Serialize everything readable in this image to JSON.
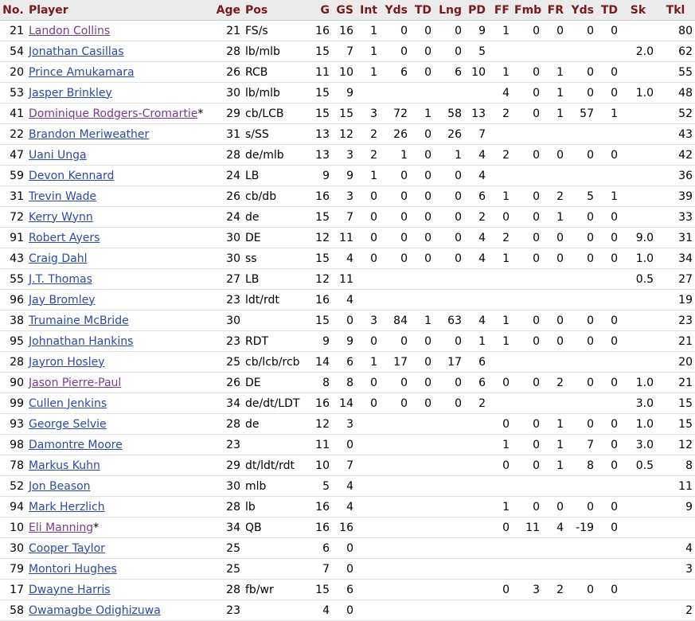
{
  "headers": [
    "No.",
    "Player",
    "Age",
    "Pos",
    "G",
    "GS",
    "Int",
    "Yds",
    "TD",
    "Lng",
    "PD",
    "FF",
    "Fmb",
    "FR",
    "Yds",
    "TD",
    "Sk",
    "Tkl"
  ],
  "rows": [
    [
      "21",
      "Landon Collins",
      "21",
      "FS/s",
      "16",
      "16",
      "1",
      "0",
      "0",
      "0",
      "9",
      "1",
      "0",
      "0",
      "0",
      "0",
      "",
      "80"
    ],
    [
      "54",
      "Jonathan Casillas",
      "28",
      "lb/mlb",
      "15",
      "7",
      "1",
      "0",
      "0",
      "0",
      "5",
      "",
      "",
      "",
      "",
      "",
      "2.0",
      "62"
    ],
    [
      "20",
      "Prince Amukamara",
      "26",
      "RCB",
      "11",
      "10",
      "1",
      "6",
      "0",
      "6",
      "10",
      "1",
      "0",
      "1",
      "0",
      "0",
      "",
      "55"
    ],
    [
      "53",
      "Jasper Brinkley",
      "30",
      "lb/mlb",
      "15",
      "9",
      "",
      "",
      "",
      "",
      "",
      "4",
      "0",
      "1",
      "0",
      "0",
      "1.0",
      "48"
    ],
    [
      "41",
      "Dominique Rodgers-Cromartie*",
      "29",
      "cb/LCB",
      "15",
      "15",
      "3",
      "72",
      "1",
      "58",
      "13",
      "2",
      "0",
      "1",
      "57",
      "1",
      "",
      "52"
    ],
    [
      "22",
      "Brandon Meriweather",
      "31",
      "s/SS",
      "13",
      "12",
      "2",
      "26",
      "0",
      "26",
      "7",
      "",
      "",
      "",
      "",
      "",
      "",
      "43"
    ],
    [
      "47",
      "Uani Unga",
      "28",
      "de/mlb",
      "13",
      "3",
      "2",
      "1",
      "0",
      "1",
      "4",
      "2",
      "0",
      "0",
      "0",
      "0",
      "",
      "42"
    ],
    [
      "59",
      "Devon Kennard",
      "24",
      "LB",
      "9",
      "9",
      "1",
      "0",
      "0",
      "0",
      "4",
      "",
      "",
      "",
      "",
      "",
      "",
      "36"
    ],
    [
      "31",
      "Trevin Wade",
      "26",
      "cb/db",
      "16",
      "3",
      "0",
      "0",
      "0",
      "0",
      "6",
      "1",
      "0",
      "2",
      "5",
      "1",
      "",
      "39"
    ],
    [
      "72",
      "Kerry Wynn",
      "24",
      "de",
      "15",
      "7",
      "0",
      "0",
      "0",
      "0",
      "2",
      "0",
      "0",
      "1",
      "0",
      "0",
      "",
      "33"
    ],
    [
      "91",
      "Robert Ayers",
      "30",
      "DE",
      "12",
      "11",
      "0",
      "0",
      "0",
      "0",
      "4",
      "2",
      "0",
      "0",
      "0",
      "0",
      "9.0",
      "31"
    ],
    [
      "43",
      "Craig Dahl",
      "30",
      "ss",
      "15",
      "4",
      "0",
      "0",
      "0",
      "0",
      "4",
      "1",
      "0",
      "0",
      "0",
      "0",
      "1.0",
      "34"
    ],
    [
      "55",
      "J.T. Thomas",
      "27",
      "LB",
      "12",
      "11",
      "",
      "",
      "",
      "",
      "",
      "",
      "",
      "",
      "",
      "",
      "0.5",
      "27"
    ],
    [
      "96",
      "Jay Bromley",
      "23",
      "ldt/rdt",
      "16",
      "4",
      "",
      "",
      "",
      "",
      "",
      "",
      "",
      "",
      "",
      "",
      "",
      "19"
    ],
    [
      "38",
      "Trumaine McBride",
      "30",
      "",
      "15",
      "0",
      "3",
      "84",
      "1",
      "63",
      "4",
      "1",
      "0",
      "0",
      "0",
      "0",
      "",
      "23"
    ],
    [
      "95",
      "Johnathan Hankins",
      "23",
      "RDT",
      "9",
      "9",
      "0",
      "0",
      "0",
      "0",
      "1",
      "1",
      "0",
      "0",
      "0",
      "0",
      "",
      "21"
    ],
    [
      "28",
      "Jayron Hosley",
      "25",
      "cb/lcb/rcb",
      "14",
      "6",
      "1",
      "17",
      "0",
      "17",
      "6",
      "",
      "",
      "",
      "",
      "",
      "",
      "20"
    ],
    [
      "90",
      "Jason Pierre-Paul",
      "26",
      "DE",
      "8",
      "8",
      "0",
      "0",
      "0",
      "0",
      "6",
      "0",
      "0",
      "2",
      "0",
      "0",
      "1.0",
      "21"
    ],
    [
      "99",
      "Cullen Jenkins",
      "34",
      "de/dt/LDT",
      "16",
      "14",
      "0",
      "0",
      "0",
      "0",
      "2",
      "",
      "",
      "",
      "",
      "",
      "3.0",
      "15"
    ],
    [
      "93",
      "George Selvie",
      "28",
      "de",
      "12",
      "3",
      "",
      "",
      "",
      "",
      "",
      "0",
      "0",
      "1",
      "0",
      "0",
      "1.0",
      "15"
    ],
    [
      "98",
      "Damontre Moore",
      "23",
      "",
      "11",
      "0",
      "",
      "",
      "",
      "",
      "",
      "1",
      "0",
      "1",
      "7",
      "0",
      "3.0",
      "12"
    ],
    [
      "78",
      "Markus Kuhn",
      "29",
      "dt/ldt/rdt",
      "10",
      "7",
      "",
      "",
      "",
      "",
      "",
      "0",
      "0",
      "1",
      "8",
      "0",
      "0.5",
      "8"
    ],
    [
      "52",
      "Jon Beason",
      "30",
      "mlb",
      "5",
      "4",
      "",
      "",
      "",
      "",
      "",
      "",
      "",
      "",
      "",
      "",
      "",
      "11"
    ],
    [
      "94",
      "Mark Herzlich",
      "28",
      "lb",
      "16",
      "4",
      "",
      "",
      "",
      "",
      "",
      "1",
      "0",
      "0",
      "0",
      "0",
      "",
      "9"
    ],
    [
      "10",
      "Eli Manning*",
      "34",
      "QB",
      "16",
      "16",
      "",
      "",
      "",
      "",
      "",
      "0",
      "11",
      "4",
      "-19",
      "0",
      "",
      ""
    ],
    [
      "30",
      "Cooper Taylor",
      "25",
      "",
      "6",
      "0",
      "",
      "",
      "",
      "",
      "",
      "",
      "",
      "",
      "",
      "",
      "",
      "4"
    ],
    [
      "79",
      "Montori Hughes",
      "25",
      "",
      "7",
      "0",
      "",
      "",
      "",
      "",
      "",
      "",
      "",
      "",
      "",
      "",
      "",
      "3"
    ],
    [
      "17",
      "Dwayne Harris",
      "28",
      "fb/wr",
      "15",
      "6",
      "",
      "",
      "",
      "",
      "",
      "0",
      "3",
      "2",
      "0",
      "0",
      "",
      ""
    ],
    [
      "58",
      "Owamagbe Odighizuwa",
      "23",
      "",
      "4",
      "0",
      "",
      "",
      "",
      "",
      "",
      "",
      "",
      "",
      "",
      "",
      "",
      "2"
    ]
  ],
  "visited_players": [
    "Landon Collins",
    "Dominique Rodgers-Cromartie",
    "Jason Pierre-Paul",
    "Eli Manning"
  ]
}
